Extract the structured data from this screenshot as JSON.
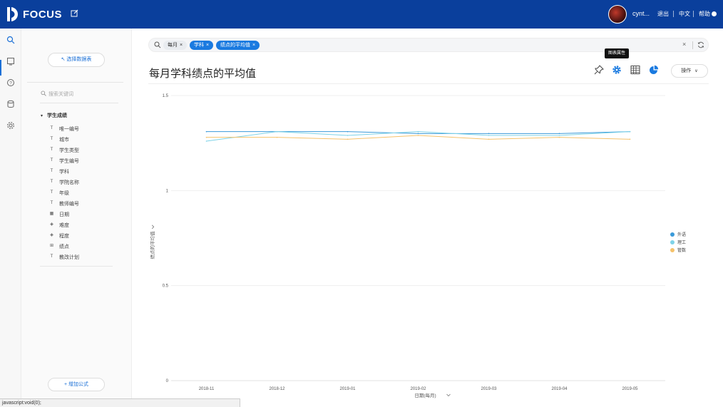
{
  "topbar": {
    "logo_text": "FOCUS",
    "username": "cynt...",
    "logout": "退出",
    "language": "中文",
    "help": "帮助"
  },
  "sidebar": {
    "select_table": "选择数据表",
    "search_placeholder": "搜索关键词",
    "tree_root": "学生成绩",
    "items": [
      {
        "label": "唯一编号",
        "icon": "text-field-icon"
      },
      {
        "label": "城市",
        "icon": "text-field-icon"
      },
      {
        "label": "学生类型",
        "icon": "text-field-icon"
      },
      {
        "label": "学生编号",
        "icon": "text-field-icon"
      },
      {
        "label": "学科",
        "icon": "text-field-icon"
      },
      {
        "label": "学院名称",
        "icon": "text-field-icon"
      },
      {
        "label": "年级",
        "icon": "text-field-icon"
      },
      {
        "label": "教师编号",
        "icon": "text-field-icon"
      },
      {
        "label": "日期",
        "icon": "calendar-field-icon"
      },
      {
        "label": "难度",
        "icon": "measure-field-icon"
      },
      {
        "label": "程度",
        "icon": "measure-field-icon"
      },
      {
        "label": "绩点",
        "icon": "number-field-icon"
      },
      {
        "label": "教改计划",
        "icon": "text-field-icon"
      }
    ],
    "add_formula": "增加公式"
  },
  "search": {
    "chips": [
      {
        "label": "每月",
        "style": "plain"
      },
      {
        "label": "学科",
        "style": "blue"
      },
      {
        "label": "绩点的平均值",
        "style": "blue"
      }
    ]
  },
  "page": {
    "title": "每月学科绩点的平均值",
    "tooltip": "图表属性",
    "operations": "操作"
  },
  "chart_data": {
    "type": "line",
    "x": [
      "2018-11",
      "2018-12",
      "2019-01",
      "2019-02",
      "2019-03",
      "2019-04",
      "2019-05"
    ],
    "xlabel": "日期(每月)",
    "ylabel": "绩点的平均值",
    "ylim": [
      0,
      1.5
    ],
    "yticks": [
      0,
      0.5,
      1,
      1.5
    ],
    "legend_position": "right",
    "series": [
      {
        "name": "外语",
        "color": "#3a9ad9",
        "values": [
          1.31,
          1.31,
          1.31,
          1.3,
          1.3,
          1.3,
          1.31
        ]
      },
      {
        "name": "理工",
        "color": "#7fd3e8",
        "values": [
          1.26,
          1.31,
          1.29,
          1.31,
          1.29,
          1.29,
          1.31
        ]
      },
      {
        "name": "管数",
        "color": "#f5c26b",
        "values": [
          1.28,
          1.28,
          1.27,
          1.29,
          1.27,
          1.28,
          1.27
        ]
      }
    ]
  },
  "status": {
    "url": "javascript:void(0);"
  }
}
